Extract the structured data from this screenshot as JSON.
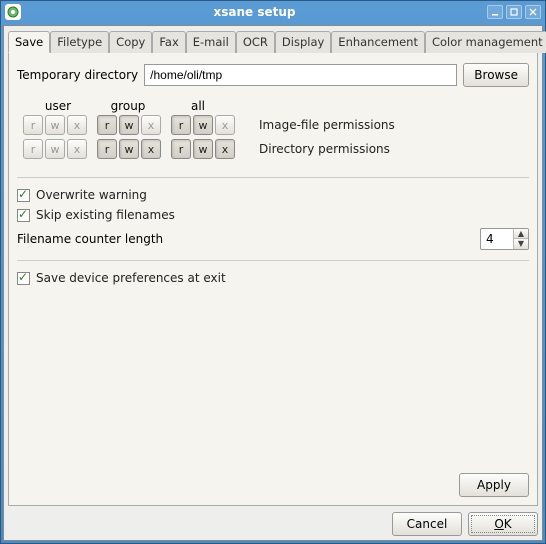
{
  "titlebar": {
    "title": "xsane setup"
  },
  "tabs": {
    "save": "Save",
    "filetype": "Filetype",
    "copy": "Copy",
    "fax": "Fax",
    "email": "E-mail",
    "ocr": "OCR",
    "display": "Display",
    "enhancement": "Enhancement",
    "colormgmt": "Color management"
  },
  "tempdir": {
    "label": "Temporary directory",
    "value": "/home/oli/tmp",
    "browse": "Browse"
  },
  "perm": {
    "headers": {
      "user": "user",
      "group": "group",
      "all": "all"
    },
    "bits": {
      "r": "r",
      "w": "w",
      "x": "x"
    },
    "rows": {
      "imagefile": "Image-file permissions",
      "directory": "Directory permissions"
    }
  },
  "checks": {
    "overwrite": "Overwrite warning",
    "skip": "Skip existing filenames",
    "savedev": "Save device preferences at exit"
  },
  "counter": {
    "label": "Filename counter length",
    "value": "4"
  },
  "buttons": {
    "apply": "Apply",
    "cancel": "Cancel",
    "ok": "OK",
    "ok_ul": "O"
  }
}
